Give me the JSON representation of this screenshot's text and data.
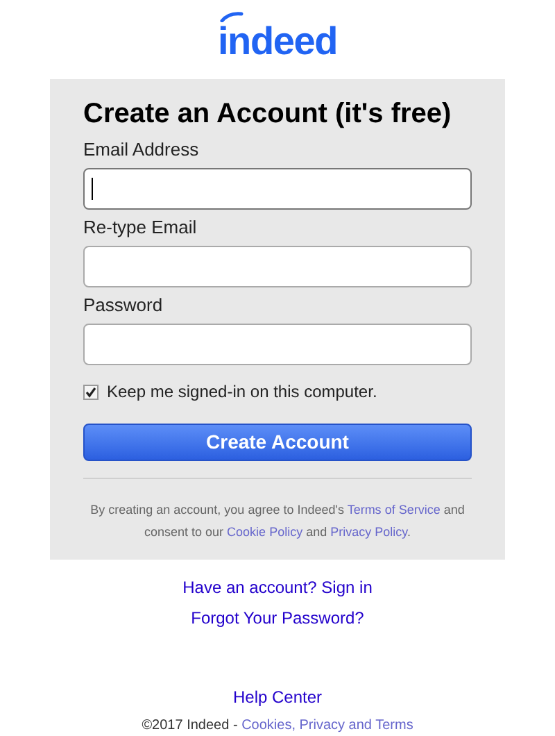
{
  "logo": {
    "text": "indeed"
  },
  "form": {
    "title": "Create an Account (it's free)",
    "fields": [
      {
        "label": "Email Address",
        "focused": true
      },
      {
        "label": "Re-type Email",
        "focused": false
      },
      {
        "label": "Password",
        "focused": false
      }
    ],
    "remember": {
      "label": "Keep me signed-in on this computer.",
      "checked": true
    },
    "submit": "Create Account",
    "terms": [
      {
        "kind": "text",
        "text": "By creating an account, you agree to Indeed's "
      },
      {
        "kind": "link",
        "text": "Terms of Service"
      },
      {
        "kind": "text",
        "text": " and consent to our "
      },
      {
        "kind": "link",
        "text": "Cookie Policy"
      },
      {
        "kind": "text",
        "text": " and "
      },
      {
        "kind": "link",
        "text": "Privacy Policy"
      },
      {
        "kind": "text",
        "text": "."
      }
    ]
  },
  "links": [
    "Have an account? Sign in",
    "Forgot Your Password?"
  ],
  "footer": {
    "help": "Help Center",
    "copyright": "©2017 Indeed - ",
    "legal": "Cookies, Privacy and Terms"
  }
}
